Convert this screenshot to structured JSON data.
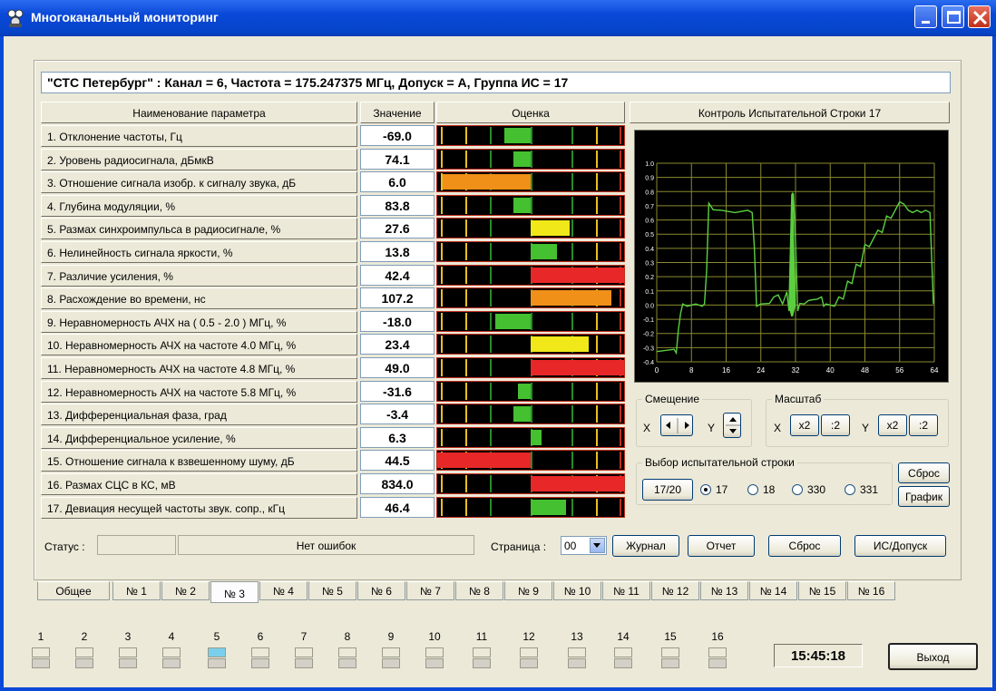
{
  "window": {
    "title": "Многоканальный мониторинг"
  },
  "header": {
    "text": "\"СТС Петербург\" :  Канал = 6,  Частота = 175.247375 МГц,  Допуск = А,  Группа ИС = 17"
  },
  "columns": {
    "name": "Наименование параметра",
    "value": "Значение",
    "score": "Оценка",
    "control": "Контроль Испытательной Строки 17"
  },
  "params": [
    {
      "name": "1. Отклонение частоты, Гц",
      "value": "-69.0",
      "bar": {
        "color": "#44c030",
        "from": 0.36,
        "to": 0.5
      }
    },
    {
      "name": "2. Уровень радиосигнала, дБмкВ",
      "value": "74.1",
      "bar": {
        "color": "#44c030",
        "from": 0.41,
        "to": 0.5
      }
    },
    {
      "name": "3. Отношение сигнала изобр. к сигналу звука, дБ",
      "value": "6.0",
      "bar": {
        "color": "#f09018",
        "from": 0.03,
        "to": 0.5
      }
    },
    {
      "name": "4. Глубина модуляции, %",
      "value": "83.8",
      "bar": {
        "color": "#44c030",
        "from": 0.41,
        "to": 0.5
      }
    },
    {
      "name": "5. Размах синхроимпульса в радиосигнале, %",
      "value": "27.6",
      "bar": {
        "color": "#f0e818",
        "from": 0.5,
        "to": 0.71
      }
    },
    {
      "name": "6. Нелинейность сигнала яркости, %",
      "value": "13.8",
      "bar": {
        "color": "#44c030",
        "from": 0.5,
        "to": 0.64
      }
    },
    {
      "name": "7. Различие усиления, %",
      "value": "42.4",
      "bar": {
        "color": "#e82828",
        "from": 0.5,
        "to": 1.0
      }
    },
    {
      "name": "8. Расхождение во времени, нс",
      "value": "107.2",
      "bar": {
        "color": "#f09018",
        "from": 0.5,
        "to": 0.93
      }
    },
    {
      "name": "9. Неравномерность АЧХ на ( 0.5 - 2.0 ) МГц, %",
      "value": "-18.0",
      "bar": {
        "color": "#44c030",
        "from": 0.31,
        "to": 0.5
      }
    },
    {
      "name": "10. Неравномерность АЧХ на частоте 4.0 МГц, %",
      "value": "23.4",
      "bar": {
        "color": "#f0e818",
        "from": 0.5,
        "to": 0.81
      }
    },
    {
      "name": "11. Неравномерность АЧХ на частоте 4.8 МГц, %",
      "value": "49.0",
      "bar": {
        "color": "#e82828",
        "from": 0.5,
        "to": 1.0
      }
    },
    {
      "name": "12. Неравномерность АЧХ на частоте 5.8 МГц, %",
      "value": "-31.6",
      "bar": {
        "color": "#44c030",
        "from": 0.43,
        "to": 0.5
      }
    },
    {
      "name": "13. Дифференциальная фаза, град",
      "value": "-3.4",
      "bar": {
        "color": "#44c030",
        "from": 0.41,
        "to": 0.5
      }
    },
    {
      "name": "14. Дифференциальное усиление, %",
      "value": "6.3",
      "bar": {
        "color": "#44c030",
        "from": 0.5,
        "to": 0.56
      }
    },
    {
      "name": "15. Отношение сигнала к взвешенному шуму, дБ",
      "value": "44.5",
      "bar": {
        "color": "#e82828",
        "from": 0.0,
        "to": 0.5
      }
    },
    {
      "name": "16. Размах СЦС в КС, мВ",
      "value": "834.0",
      "bar": {
        "color": "#e82828",
        "from": 0.5,
        "to": 1.0
      }
    },
    {
      "name": "17. Девиация несущей частоты звук. сопр., кГц",
      "value": "46.4",
      "bar": {
        "color": "#44c030",
        "from": 0.5,
        "to": 0.69
      }
    }
  ],
  "chart_data": {
    "type": "line",
    "title": "",
    "xlim": [
      0,
      64
    ],
    "ylim": [
      -0.4,
      1.0
    ],
    "x_ticks": [
      "0",
      "8",
      "16",
      "24",
      "32",
      "40",
      "48",
      "56",
      "64"
    ],
    "y_ticks": [
      "1.0",
      "0.9",
      "0.8",
      "0.7",
      "0.6",
      "0.5",
      "0.4",
      "0.3",
      "0.2",
      "0.1",
      "0.0",
      "-0.1",
      "-0.2",
      "-0.3",
      "-0.4"
    ],
    "grid": true,
    "series": [
      {
        "color": "#5ad040",
        "x": [
          0,
          4,
          4.5,
          5,
          5.5,
          6,
          7,
          9,
          10.5,
          11,
          11.5,
          12,
          13,
          15,
          18,
          21,
          22,
          22.5,
          23,
          24,
          26,
          27,
          28,
          29,
          30,
          30.5,
          31,
          31.5,
          32,
          32.5,
          33,
          34,
          35,
          36,
          37,
          38,
          38.5,
          39,
          41,
          42,
          43,
          44,
          45,
          46,
          47,
          48,
          49,
          51,
          52,
          53,
          54,
          56,
          57,
          58,
          59,
          60,
          61,
          62,
          63,
          63.8
        ],
        "y": [
          -0.32,
          -0.32,
          -0.33,
          -0.18,
          -0.05,
          0.0,
          0.0,
          0.0,
          0.0,
          0.0,
          0.25,
          0.71,
          0.68,
          0.66,
          0.66,
          0.66,
          0.66,
          0.4,
          0.0,
          0.0,
          0.02,
          0.05,
          0.08,
          0.0,
          0.1,
          -0.05,
          0.3,
          0.78,
          0.45,
          -0.05,
          0.02,
          0.0,
          0.04,
          0.03,
          0.05,
          0.05,
          0.0,
          0.0,
          0.0,
          0.05,
          0.05,
          0.16,
          0.16,
          0.28,
          0.28,
          0.42,
          0.42,
          0.52,
          0.52,
          0.62,
          0.62,
          0.72,
          0.72,
          0.66,
          0.66,
          0.66,
          0.66,
          0.66,
          0.66,
          0.0
        ]
      }
    ]
  },
  "offset_group": {
    "label": "Смещение",
    "x": "X",
    "y": "Y"
  },
  "scale_group": {
    "label": "Масштаб",
    "x": "X",
    "y": "Y",
    "x2": "x2",
    "div2": ":2",
    "y_x2": "x2",
    "y_div2": ":2"
  },
  "line_select": {
    "label": "Выбор испытательной строки",
    "button": "17/20",
    "options": [
      "17",
      "18",
      "330",
      "331"
    ],
    "selected": "17"
  },
  "side_buttons": {
    "reset": "Сброс",
    "graph": "График"
  },
  "status": {
    "label": "Статус :",
    "message": "Нет ошибок",
    "page_label": "Страница :",
    "page_value": "00"
  },
  "actions": {
    "journal": "Журнал",
    "report": "Отчет",
    "reset": "Сброс",
    "tolerance": "ИС/Допуск"
  },
  "tabs": [
    "Общее",
    "№ 1",
    "№ 2",
    "№ 3",
    "№ 4",
    "№ 5",
    "№ 6",
    "№ 7",
    "№ 8",
    "№ 9",
    "№ 10",
    "№ 11",
    "№ 12",
    "№ 13",
    "№ 14",
    "№ 15",
    "№ 16"
  ],
  "active_tab": "№ 3",
  "channels": [
    "1",
    "2",
    "3",
    "4",
    "5",
    "6",
    "7",
    "8",
    "9",
    "10",
    "11",
    "12",
    "13",
    "14",
    "15",
    "16"
  ],
  "active_channel": "5",
  "clock": "15:45:18",
  "exit_label": "Выход"
}
